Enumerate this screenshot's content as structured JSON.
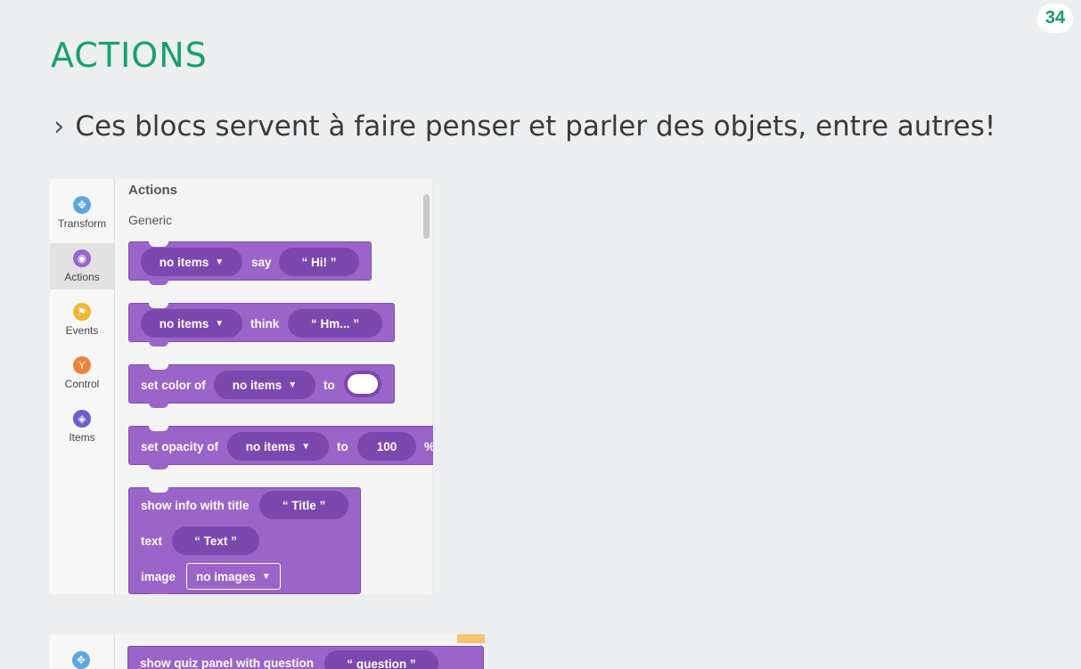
{
  "page_number": "34",
  "title": "ACTIONS",
  "subtitle": "Ces blocs servent à faire penser et parler des objets, entre autres!",
  "subtitle_bullet": "›",
  "sidebar": {
    "items": [
      {
        "label": "Transform",
        "color": "#5aa7e3",
        "icon": "move-icon"
      },
      {
        "label": "Actions",
        "color": "#9a64c9",
        "icon": "eye-icon"
      },
      {
        "label": "Events",
        "color": "#f2b632",
        "icon": "flag-icon"
      },
      {
        "label": "Control",
        "color": "#f0813a",
        "icon": "branch-icon"
      },
      {
        "label": "Items",
        "color": "#6a5ed1",
        "icon": "cube-icon"
      }
    ]
  },
  "workspace": {
    "heading": "Actions",
    "subheading": "Generic",
    "blocks": {
      "say": {
        "subject": "no items",
        "verb": "say",
        "text": "“  Hi!  ”"
      },
      "think": {
        "subject": "no items",
        "verb": "think",
        "text": "“  Hm...  ”"
      },
      "color": {
        "prefix": "set color of",
        "subject": "no items",
        "to": "to"
      },
      "opacity": {
        "prefix": "set opacity of",
        "subject": "no items",
        "to": "to",
        "value": "100",
        "unit": "%"
      },
      "info": {
        "title_label": "show info with title",
        "title_value": "“  Title  ”",
        "text_label": "text",
        "text_value": "“  Text  ”",
        "image_label": "image",
        "image_value": "no images"
      }
    }
  },
  "second_panel": {
    "block_label": "show quiz panel with question",
    "question_value": "“  question  ”"
  },
  "colors": {
    "title_green": "#16a071",
    "block_purple": "#9a64c9",
    "pill_purple": "#7b48b0"
  }
}
